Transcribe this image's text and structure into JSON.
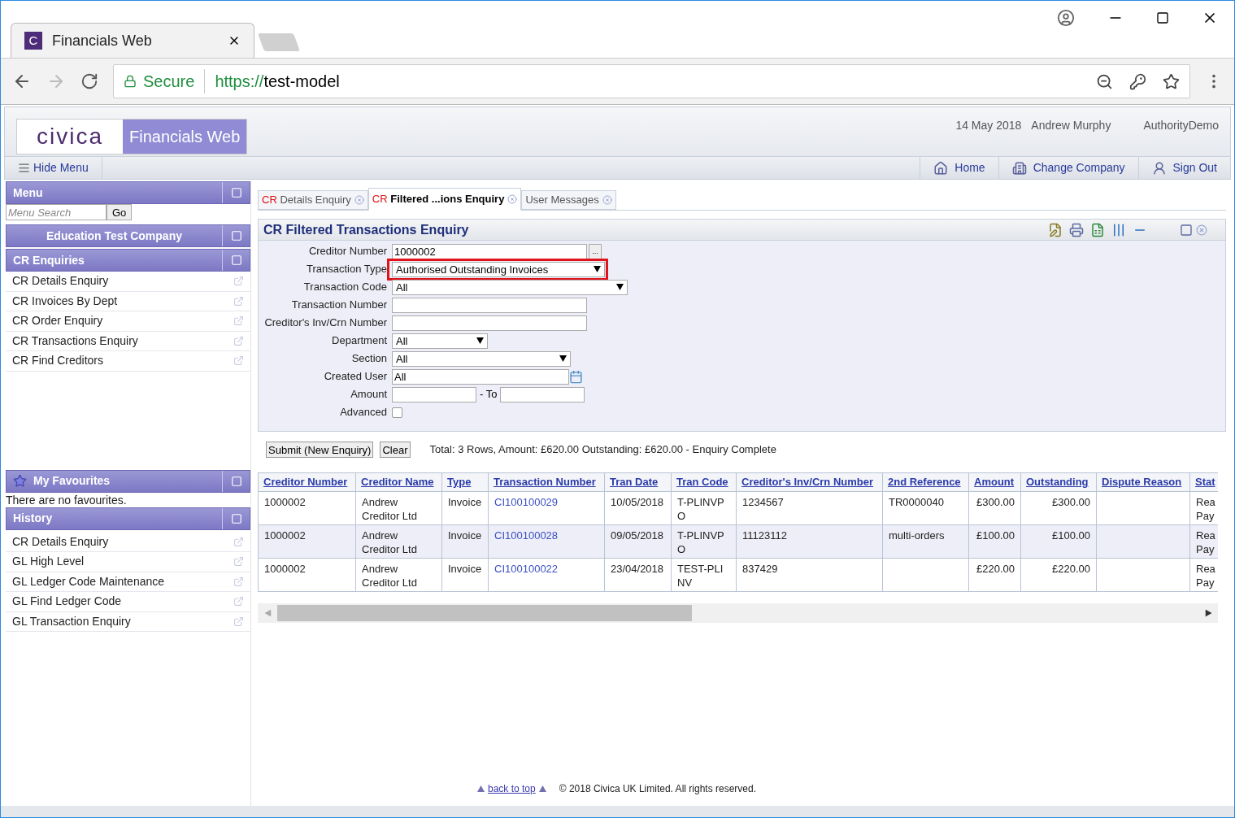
{
  "browser": {
    "tab_title": "Financials Web",
    "favicon": "C",
    "secure": "Secure",
    "url_scheme": "https://",
    "url_host": "test-model"
  },
  "header": {
    "logo": "civica",
    "app_name": "Financials Web",
    "date": "14 May 2018",
    "user": "Andrew Murphy",
    "authority": "AuthorityDemo"
  },
  "toolbar": {
    "hide_menu": "Hide Menu",
    "links": [
      {
        "kind": "home",
        "label": "Home"
      },
      {
        "kind": "company",
        "label": "Change Company"
      },
      {
        "kind": "signout",
        "label": "Sign Out"
      }
    ]
  },
  "sidebar": {
    "menu_title": "Menu",
    "search_placeholder": "Menu Search",
    "go": "Go",
    "company": "Education Test Company",
    "section_title": "CR Enquiries",
    "items": [
      "CR Details Enquiry",
      "CR Invoices By Dept",
      "CR Order Enquiry",
      "CR Transactions Enquiry",
      "CR Find Creditors"
    ],
    "favourites_title": "My Favourites",
    "favourites_empty": "There are no favourites.",
    "history_title": "History",
    "history": [
      "CR Details Enquiry",
      "GL High Level",
      "GL Ledger Code Maintenance",
      "GL Find Ledger Code",
      "GL Transaction Enquiry"
    ]
  },
  "tabs": [
    {
      "prefix": "CR",
      "label": "Details Enquiry",
      "selected": false
    },
    {
      "prefix": "CR",
      "label": "Filtered ...ions Enquiry",
      "selected": true
    },
    {
      "label": "User Messages",
      "selected": false
    }
  ],
  "form": {
    "title": "CR Filtered Transactions Enquiry",
    "fields": [
      {
        "kind": "lookup",
        "label": "Creditor Number",
        "value": "1000002",
        "button": "...",
        "highlighted": false
      },
      {
        "kind": "select",
        "label": "Transaction Type",
        "value": "Authorised Outstanding Invoices",
        "highlighted": true
      },
      {
        "kind": "select",
        "label": "Transaction Code",
        "value": "All",
        "highlighted": false
      },
      {
        "kind": "text",
        "label": "Transaction Number",
        "highlighted": false
      },
      {
        "kind": "text",
        "label": "Creditor's Inv/Crn Number",
        "highlighted": false
      },
      {
        "kind": "select",
        "label": "Department",
        "value": "All",
        "highlighted": false
      },
      {
        "kind": "select",
        "label": "Section",
        "value": "All",
        "highlighted": false
      },
      {
        "kind": "picker",
        "label": "Created User",
        "value": "All",
        "highlighted": false
      },
      {
        "kind": "range",
        "label": "Amount",
        "separator": "- To",
        "highlighted": false
      },
      {
        "kind": "checkbox",
        "label": "Advanced",
        "checked": false,
        "highlighted": false
      }
    ]
  },
  "actions": {
    "submit": "Submit (New Enquiry)",
    "clear": "Clear",
    "summary": "Total: 3 Rows, Amount: £620.00 Outstanding: £620.00 - Enquiry Complete"
  },
  "table": {
    "columns": [
      "Creditor Number",
      "Creditor Name",
      "Type",
      "Transaction Number",
      "Tran Date",
      "Tran Code",
      "Creditor's Inv/Crn Number",
      "2nd Reference",
      "Amount",
      "Outstanding",
      "Dispute Reason",
      "Stat"
    ],
    "rows": [
      [
        "1000002",
        "Andrew Creditor Ltd",
        "Invoice",
        "CI100100029",
        "10/05/2018",
        "T-PLINVPO",
        "1234567",
        "TR0000040",
        "£300.00",
        "£300.00",
        "",
        "Rea Pay"
      ],
      [
        "1000002",
        "Andrew Creditor Ltd",
        "Invoice",
        "CI100100028",
        "09/05/2018",
        "T-PLINVPO",
        "11123112",
        "multi-orders",
        "£100.00",
        "£100.00",
        "",
        "Rea Pay"
      ],
      [
        "1000002",
        "Andrew Creditor Ltd",
        "Invoice",
        "CI100100022",
        "23/04/2018",
        "TEST-PLINV",
        "837429",
        "",
        "£220.00",
        "£220.00",
        "",
        "Rea Pay"
      ]
    ]
  },
  "footer": {
    "back_to_top": "back to top",
    "copyright": "© 2018 Civica UK Limited. All rights reserved."
  }
}
